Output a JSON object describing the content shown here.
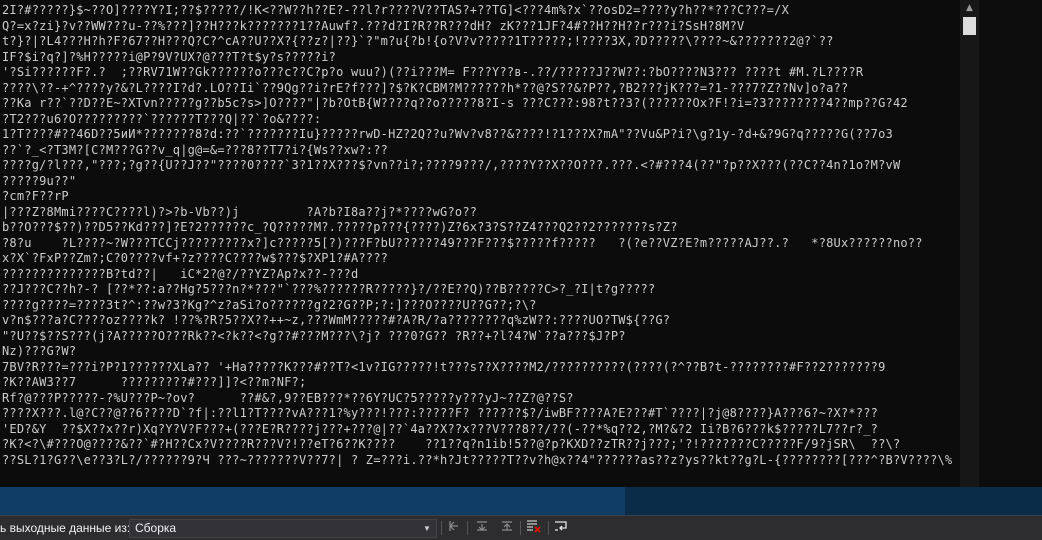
{
  "console": {
    "lines": [
      "2I?#?????}$~??O]????Y?I;??$?????/!K<??W??h??E?-??l?r????V??TAS?+??TG]<???4m%?x`??osD2=????y?h??*???C???=/X",
      "Q?=x?zi}?v??WW???u-??%???]??H???k???????1??Auwf?.???d?I?R??R???dH? zK???1JF?4#??H??H??r???i?SsH?8M?V",
      "t?}?|?L4???H?h?F?67??H???Q?C?^cA??U??X?{??z?|??}`?\"m?u{?b!{o?V?v?????1T?????;!????3X,?D?????\\????~&???????2@?`??",
      "IF?$i?q?]?%H?????i@P?9V?UX?@???T?t$y?s?????i?",
      "'?Si??????F?.?  ;??RV71W??Gk??????o???c??C?p?o wuu?)(??i???M= F???Y??в-.??/?????J??W??:?bO????N3??? ????t #M.?L????R",
      "????\\??-+^????y?&?L????I?d?.LO??Ii`??9Qg??i?rE?f???]?$?K?CBM?M??????h*??@?S??&?P??,?B2???jK???=?1-???7?Z??Nv]o?a??",
      "??Ka r??`??D??E~?XTvn?????g??b5c?s>]O????\"|?b?OtB{W????q??o?????8?I-s ???C???:98?t??3?(??????Ox?F!?i=?3????????4??mp??G?42",
      "?T2???u6?O?????????`??????T???Q|??`?o&????:",
      "1?T????#??46D??5иИ*???????8?d:??`???????Iu}?????rwD-HZ?2Q??u?Wv?v8??&????!?1???X?mA\"??Vu&P?i?\\g?1y-?d+&?9G?q?????G(??7o3",
      "??`?_<?T3M?[C?M???G??v_q|g@=&=???8??T7?i?{Ws??xw?:??",
      "????g/?l???,\"???;?g??{U??J??\"????0????`3?1??X???$?vn??i?;????9???/,????Y??X??O???.???.<?#???4(??\"?p??X???(??C??4n?1o?M?vW",
      "?????9u??\"",
      "?cm?F??rP",
      "|???Z?8Mmi????C????l)?>?b-Vb??)j         ?A?b?I8a??j?*????wG?o??",
      "b??O???$??)??D5??Kd???]?E?2??????c_?Q?????M?.?????p???{????)Z?6x?3?S??Z4???Q2??2???????s?Z?",
      "?8?u    ?L????~?W???TCCj?????????x?]c?????5[?)???F?bU??????49???F???$?????f?????   ?(?e??VZ?E?m?????AJ??.?   *?8Ux??????no??",
      "x?X`?FxP??Zm?;C?0????vf+?z????C????w$???$?XP1?#A????",
      "??????????????B?td??|   iC*2?@?/??YZ?Ap?x??-???d",
      "??J???C??h?-? [??*??:a??Hg?5???n?*???\"`???%??????R?????}?/??E??Q)??B?????C>?_?I|t?g?????",
      "????g????=????3t?^:??w?3?Kg?^z?aSi?o??????g?2?G??P;?:]???O????U??G??;?\\?",
      "v?n$???a?C????oz????k? !??%?R?5??X??++~z,???WmM?????#?A?R/?a????????q%zW??:????UO?TW${??G?",
      "\"?U??$??S???(j?A?????O???Rk??<?k??<?g??#???M???\\?j? ???0?G?? ?R??+?l?4?W`??a???$J?P?",
      "Nz)???G?W?",
      "7BV?R???=???i?P?1??????XLa?? '+Ha?????K???#??T?<1v?IG?????!t???s??X????M2/??????????(????(?^??B?t-????????#F??2???????9",
      "?K??AW3??7      ?????????#???]]?<??m?NF?;",
      "Rf?@???P?????-?%U???P~?ov?      ??#&?,9??EB???*??6Y?UC?5?????y???yJ~??Z?@??S?",
      "????X???.l@?C??@??6????D`?f|:??l1?T????vA???1?%y???!???:?????F? ??????$?/iwBF????A?E???#T`????|?j@8????}A???6?~?X?*???",
      "'ED?&Y  ??$X??x??r)Xq?Y?V?F???+(???E?R????j???+???@|??`4a??X??x???V???8??/??(-??*%q??2,?M?&?2 Ii?B?6???k$?????L7??r?_?",
      "?K?<?\\#???O@????&??`#?H??Cx?V????R???V?!??eT?6??K????    ??1??q?n1ib!5??@?p?KXD??zTR??j???;'?!???????C?????F/9?jSR\\  ??\\?",
      "??SL?1?G??\\e??3?L?/??????9?Ч ???~???????V??7?| ? Z=???i.??*h?Jt?????T??v?h@x??4\"??????as??z?ys??kt??g?L-{????????[???^?B?V????\\%"
    ]
  },
  "progress": {
    "fraction": 0.6
  },
  "output_panel": {
    "label": "ь выходные данные из:",
    "source_value": "Сборка",
    "toolbar_icons": [
      "go-to-previous-message-icon",
      "go-to-next-message-icon",
      "scroll-to-end-icon",
      "clear-all-icon",
      "toggle-word-wrap-icon"
    ]
  },
  "colors": {
    "console_bg": "#0c0c0c",
    "console_text": "#cccccc",
    "scrollbar_thumb": "#dcdcdc",
    "progress_strip": "#0b2c49",
    "output_bar_bg": "#2d2d30",
    "clear_icon_accent": "#e51400"
  }
}
